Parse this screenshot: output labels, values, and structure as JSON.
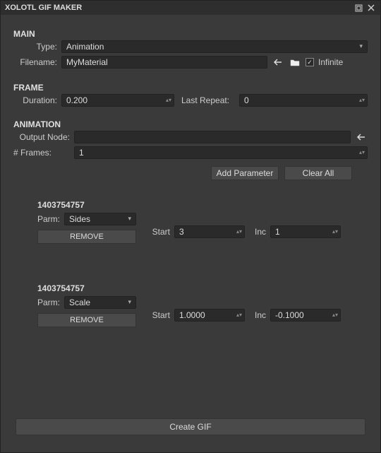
{
  "window": {
    "title": "XOLOTL GIF MAKER"
  },
  "main": {
    "heading": "MAIN",
    "typeLabel": "Type:",
    "typeValue": "Animation",
    "filenameLabel": "Filename:",
    "filenameValue": "MyMaterial",
    "infiniteLabel": "Infinite",
    "infiniteChecked": "✓"
  },
  "frame": {
    "heading": "FRAME",
    "durationLabel": "Duration:",
    "durationValue": "0.200",
    "lastRepeatLabel": "Last Repeat:",
    "lastRepeatValue": "0"
  },
  "animation": {
    "heading": "ANIMATION",
    "outputNodeLabel": "Output Node:",
    "outputNodeValue": "",
    "framesLabel": "# Frames:",
    "framesValue": "1",
    "addParamLabel": "Add Parameter",
    "clearAllLabel": "Clear All"
  },
  "params": [
    {
      "id": "1403754757",
      "parmLabel": "Parm:",
      "parmValue": "Sides",
      "removeLabel": "REMOVE",
      "startLabel": "Start",
      "startValue": "3",
      "incLabel": "Inc",
      "incValue": "1"
    },
    {
      "id": "1403754757",
      "parmLabel": "Parm:",
      "parmValue": "Scale",
      "removeLabel": "REMOVE",
      "startLabel": "Start",
      "startValue": "1.0000",
      "incLabel": "Inc",
      "incValue": "-0.1000"
    }
  ],
  "createGifLabel": "Create GIF"
}
